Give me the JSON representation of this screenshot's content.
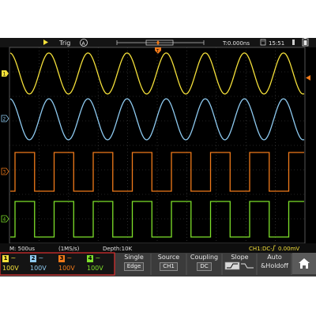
{
  "status_bar": {
    "trigger_state": "Trig",
    "trigger_mode_glyph": "A",
    "time_offset": "T:0.000ns",
    "clock": "15:51"
  },
  "info_bar": {
    "timebase": "M: 500us",
    "sample_rate": "(1MS/s)",
    "depth": "Depth:10K",
    "trigger_info": "CH1:DC-",
    "trigger_level": "0.00mV"
  },
  "channels": [
    {
      "num": "1",
      "coupling_glyph": "~",
      "vdiv": "100V",
      "color": "#f4e03a"
    },
    {
      "num": "2",
      "coupling_glyph": "~",
      "vdiv": "100V",
      "color": "#8ecaf0"
    },
    {
      "num": "3",
      "coupling_glyph": "~",
      "vdiv": "100V",
      "color": "#f07a1a"
    },
    {
      "num": "4",
      "coupling_glyph": "~",
      "vdiv": "100V",
      "color": "#7ee02a"
    }
  ],
  "menu": {
    "single": {
      "label": "Single",
      "value": "Edge"
    },
    "source": {
      "label": "Source",
      "value": "CH1"
    },
    "coupling": {
      "label": "Coupling",
      "value": "DC"
    },
    "slope": {
      "label": "Slope"
    },
    "auto": {
      "label1": "Auto",
      "label2": "&Holdoff"
    }
  },
  "icons": [
    "play-icon",
    "trigger-marker-icon",
    "clock-icon",
    "usb-icon",
    "battery-icon",
    "home-icon",
    "rising-edge-icon"
  ],
  "colors": {
    "background": "#000000",
    "grid": "#6a6a6a",
    "status_bar": "#1a1a1a",
    "menu_bar": "#3b3b3b",
    "channel_panel_border": "#e03030",
    "text": "#e6e6e6"
  }
}
